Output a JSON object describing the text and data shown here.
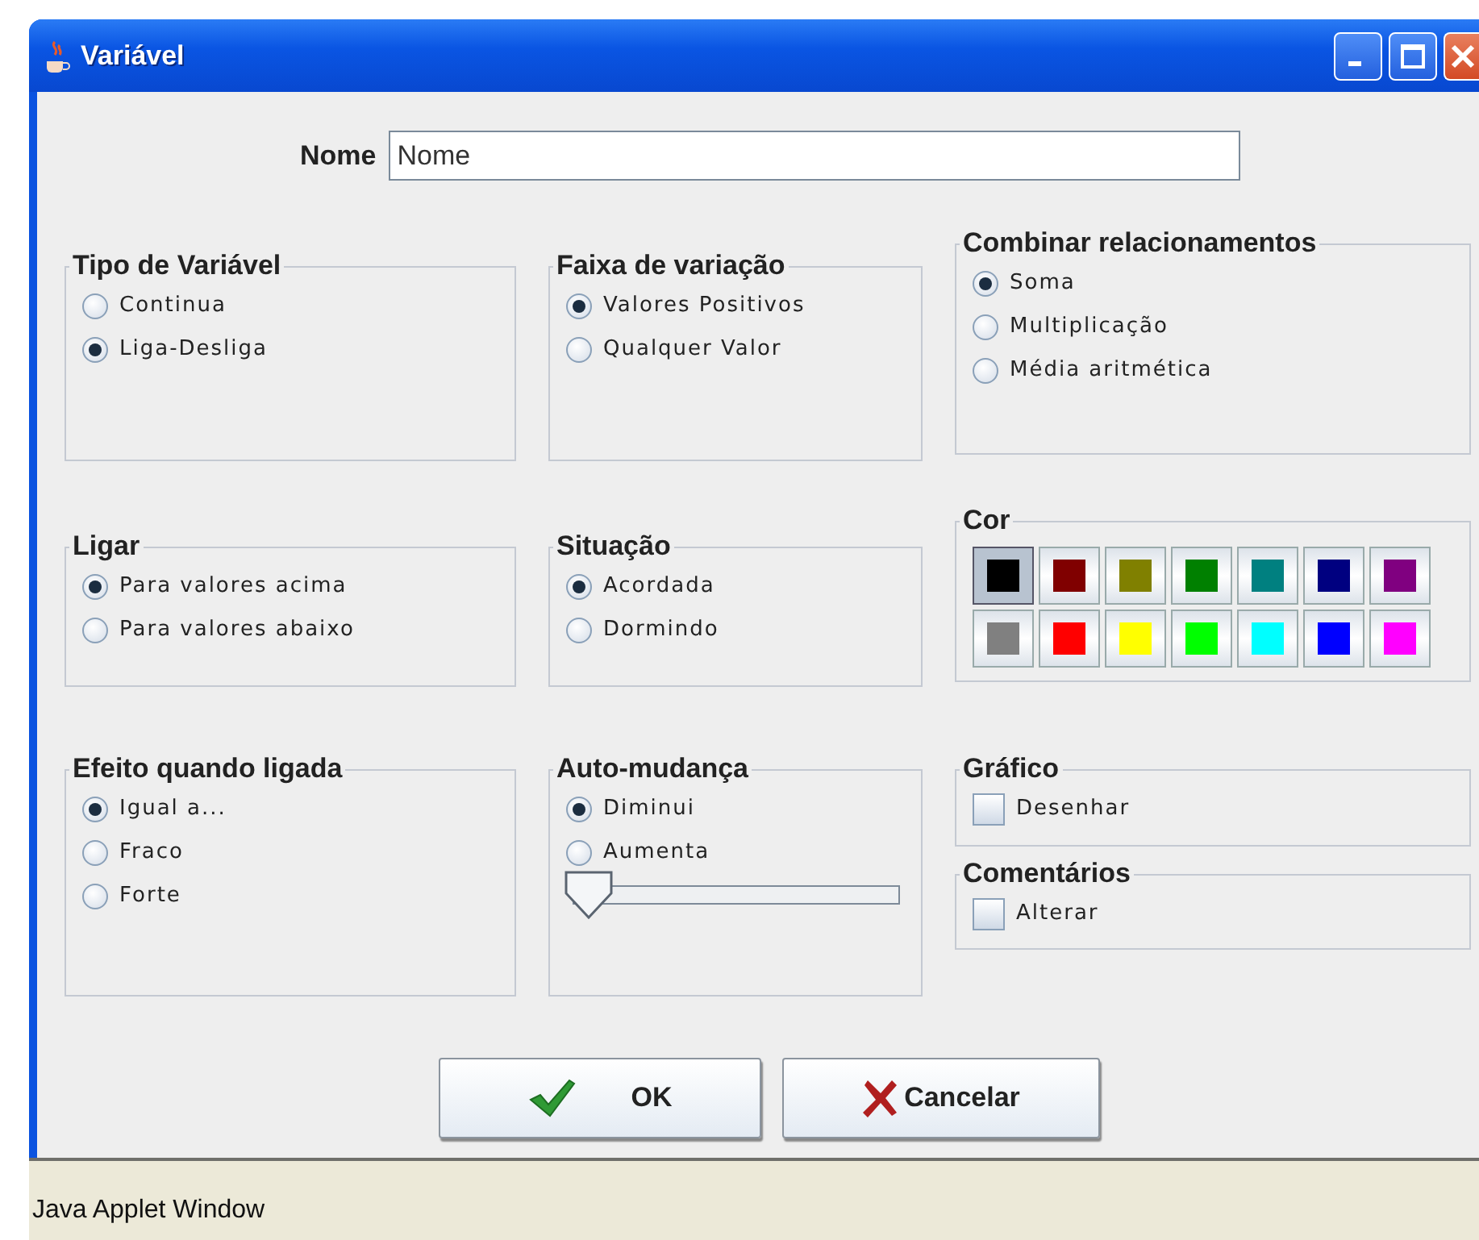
{
  "window": {
    "title": "Variável"
  },
  "name_field": {
    "label": "Nome",
    "value": "Nome"
  },
  "rows": [
    [
      [
        {
          "kind": "radio",
          "title": "Tipo de Variável",
          "options": [
            {
              "label": "Continua",
              "selected": false
            },
            {
              "label": "Liga-Desliga",
              "selected": true
            }
          ]
        }
      ],
      [
        {
          "kind": "radio",
          "title": "Faixa de variação",
          "options": [
            {
              "label": "Valores Positivos",
              "selected": true
            },
            {
              "label": "Qualquer Valor",
              "selected": false
            }
          ]
        }
      ],
      [
        {
          "kind": "radio",
          "title": "Combinar relacionamentos",
          "options": [
            {
              "label": "Soma",
              "selected": true
            },
            {
              "label": "Multiplicação",
              "selected": false
            },
            {
              "label": "Média aritmética",
              "selected": false
            }
          ]
        }
      ]
    ],
    [
      [
        {
          "kind": "radio",
          "title": "Ligar",
          "options": [
            {
              "label": "Para valores acima",
              "selected": true
            },
            {
              "label": "Para valores abaixo",
              "selected": false
            }
          ]
        }
      ],
      [
        {
          "kind": "radio",
          "title": "Situação",
          "options": [
            {
              "label": "Acordada",
              "selected": true
            },
            {
              "label": "Dormindo",
              "selected": false
            }
          ]
        }
      ],
      [
        {
          "kind": "colors",
          "title": "Cor",
          "swatches": [
            {
              "color": "#000000",
              "selected": true
            },
            {
              "color": "#800000",
              "selected": false
            },
            {
              "color": "#808000",
              "selected": false
            },
            {
              "color": "#008000",
              "selected": false
            },
            {
              "color": "#008080",
              "selected": false
            },
            {
              "color": "#000080",
              "selected": false
            },
            {
              "color": "#800080",
              "selected": false
            },
            {
              "color": "#808080",
              "selected": false
            },
            {
              "color": "#ff0000",
              "selected": false
            },
            {
              "color": "#ffff00",
              "selected": false
            },
            {
              "color": "#00ff00",
              "selected": false
            },
            {
              "color": "#00ffff",
              "selected": false
            },
            {
              "color": "#0000ff",
              "selected": false
            },
            {
              "color": "#ff00ff",
              "selected": false
            }
          ]
        }
      ]
    ],
    [
      [
        {
          "kind": "radio",
          "title": "Efeito quando ligada",
          "options": [
            {
              "label": "Igual a...",
              "selected": true
            },
            {
              "label": "Fraco",
              "selected": false
            },
            {
              "label": "Forte",
              "selected": false
            }
          ]
        }
      ],
      [
        {
          "kind": "radio_slider",
          "title": "Auto-mudança",
          "options": [
            {
              "label": "Diminui",
              "selected": true
            },
            {
              "label": "Aumenta",
              "selected": false
            }
          ],
          "slider": {
            "level": 0
          }
        }
      ],
      [
        {
          "kind": "checkbox",
          "title": "Gráfico",
          "options": [
            {
              "label": "Desenhar",
              "checked": false
            }
          ]
        },
        {
          "kind": "checkbox",
          "title": "Comentários",
          "options": [
            {
              "label": "Alterar",
              "checked": false
            }
          ]
        }
      ]
    ]
  ],
  "buttons": [
    {
      "kind": "ok",
      "label": "OK"
    },
    {
      "kind": "cancel",
      "label": "Cancelar"
    }
  ],
  "status_bar": "Java Applet Window"
}
